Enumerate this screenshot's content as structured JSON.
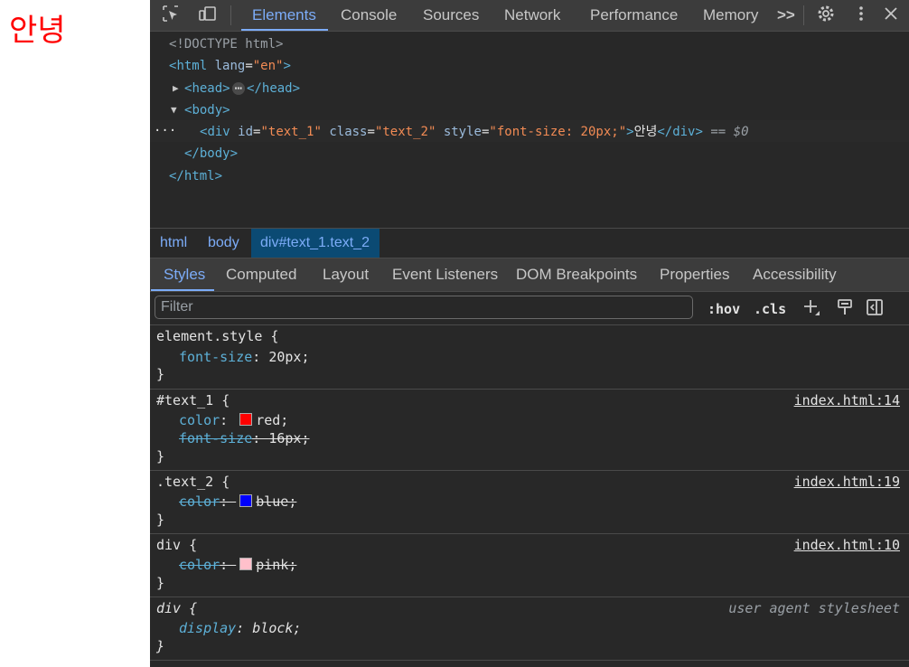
{
  "page": {
    "text": "안녕"
  },
  "toolbar": {
    "tabs": [
      "Elements",
      "Console",
      "Sources",
      "Network",
      "Performance",
      "Memory"
    ],
    "more_label": ">>"
  },
  "dom": {
    "doctype": "<!DOCTYPE html>",
    "html_tag": "html",
    "lang_attr": "lang",
    "lang_value": "\"en\"",
    "head_tag": "head",
    "body_tag": "body",
    "div_tag": "div",
    "div_id_attr": "id",
    "div_id_value": "\"text_1\"",
    "div_class_attr": "class",
    "div_class_value": "\"text_2\"",
    "div_style_attr": "style",
    "div_style_value": "\"font-size: 20px;\"",
    "div_text": "안녕",
    "selected_marker": "== $0",
    "dots": "···",
    "ellipsis": "⋯"
  },
  "breadcrumb": [
    "html",
    "body",
    "div#text_1.text_2"
  ],
  "subtabs": [
    "Styles",
    "Computed",
    "Layout",
    "Event Listeners",
    "DOM Breakpoints",
    "Properties",
    "Accessibility"
  ],
  "filter": {
    "placeholder": "Filter",
    "hov": ":hov",
    "cls": ".cls"
  },
  "rules": {
    "r1": {
      "selector": "element.style {",
      "prop": "font-size",
      "value": "20px;",
      "close": "}"
    },
    "r2": {
      "selector": "#text_1 {",
      "source": "index.html:14",
      "p1": "color",
      "v1": "red;",
      "c1": "#ff0000",
      "p2": "font-size",
      "v2": "16px;",
      "close": "}"
    },
    "r3": {
      "selector": ".text_2 {",
      "source": "index.html:19",
      "p1": "color",
      "v1": "blue;",
      "c1": "#0000ff",
      "close": "}"
    },
    "r4": {
      "selector": "div {",
      "source": "index.html:10",
      "p1": "color",
      "v1": "pink;",
      "c1": "#ffc0cb",
      "close": "}"
    },
    "r5": {
      "selector": "div {",
      "source": "user agent stylesheet",
      "p1": "display",
      "v1": "block;",
      "close": "}"
    }
  }
}
